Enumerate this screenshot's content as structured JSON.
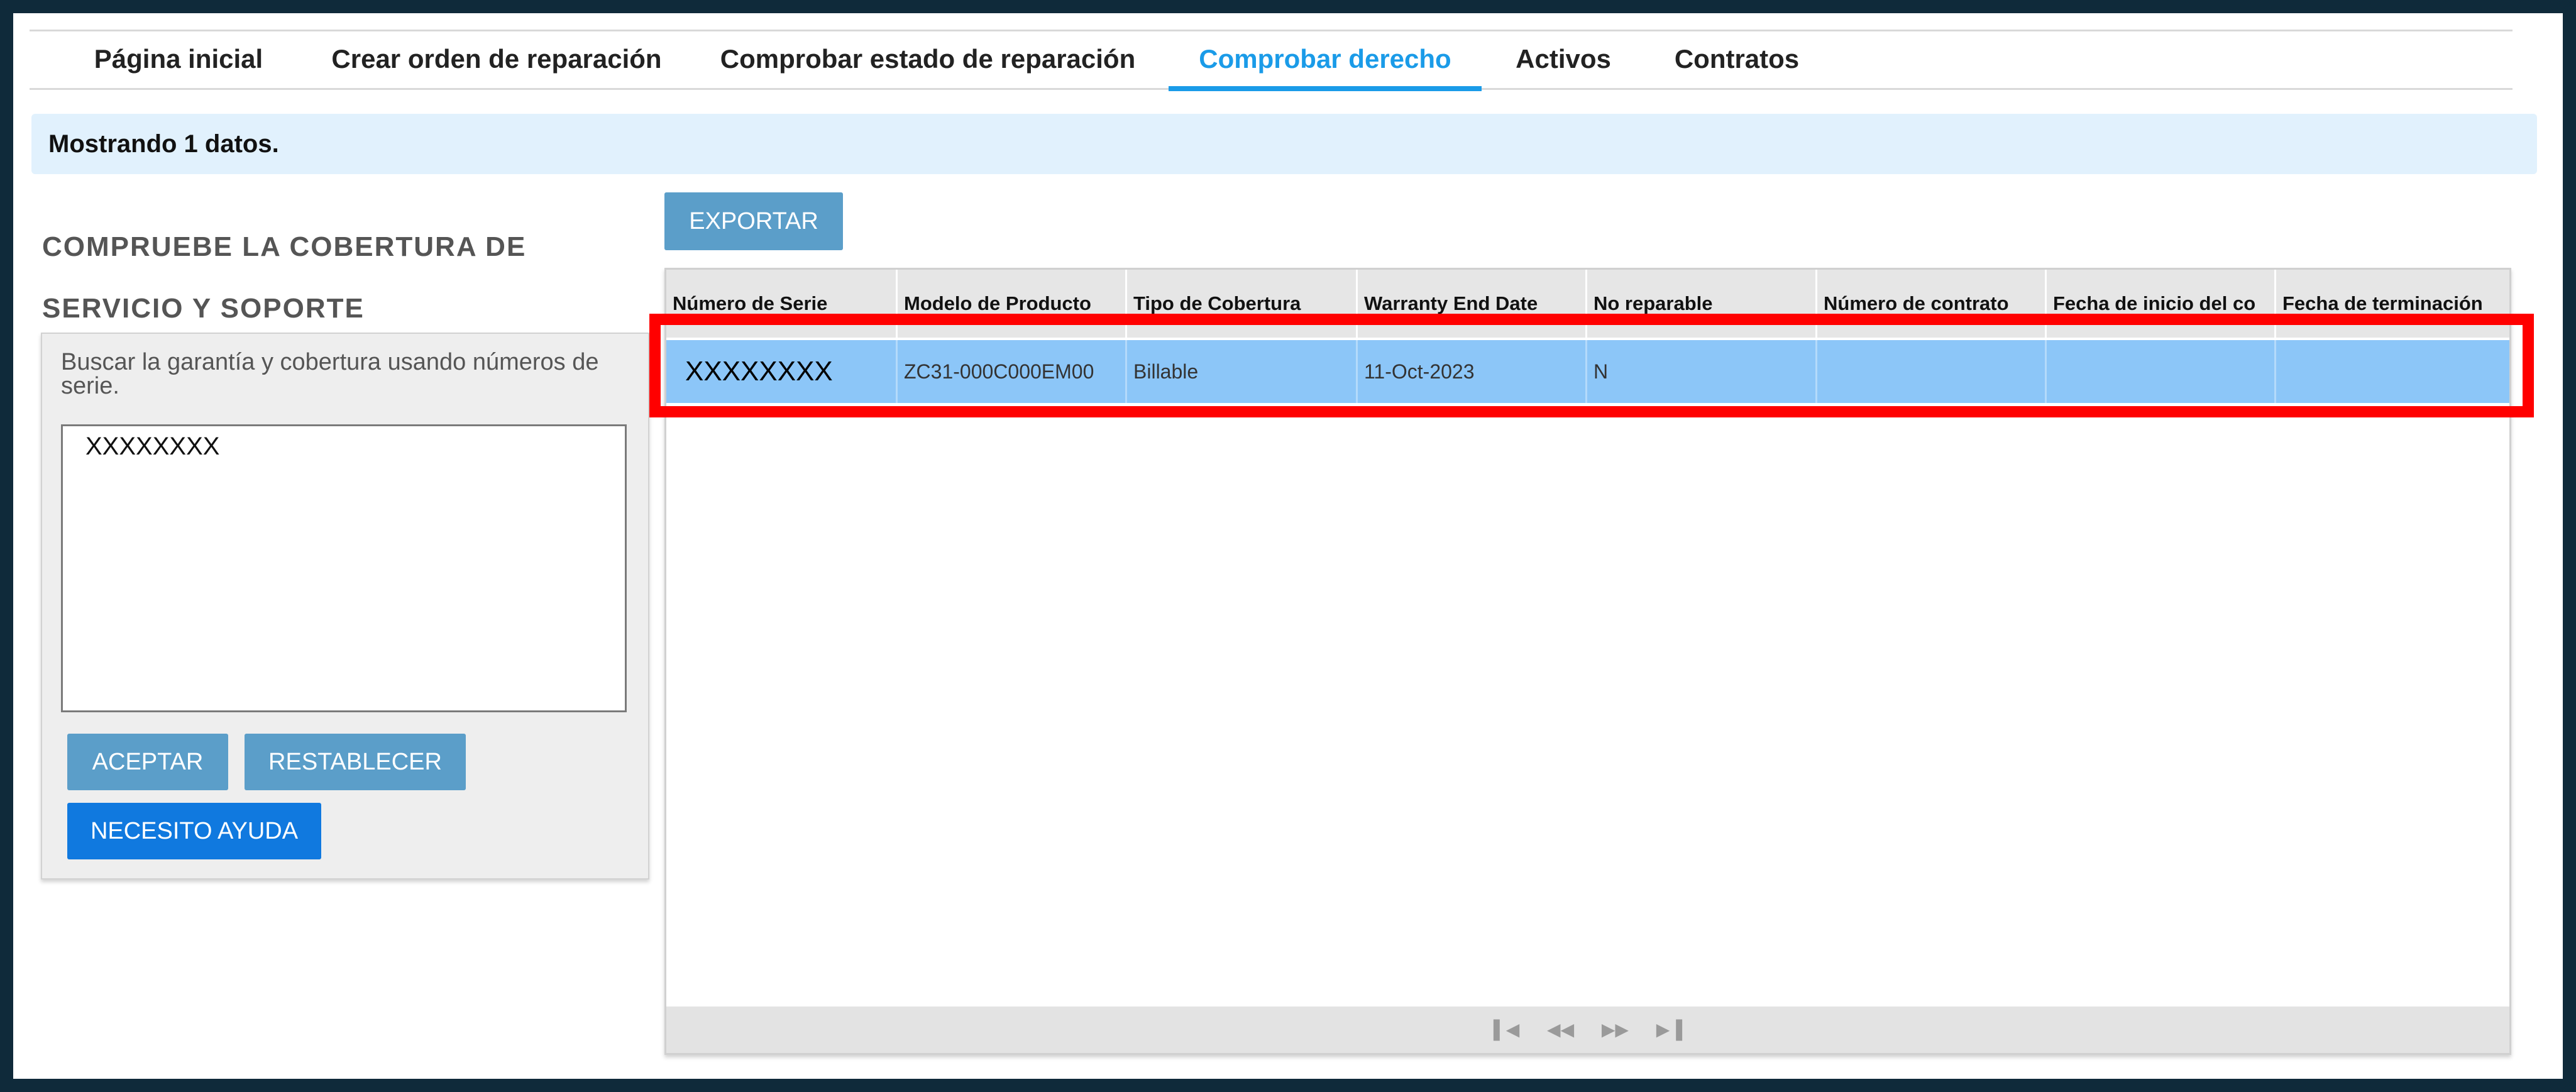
{
  "nav": {
    "tabs": [
      {
        "label": "Página inicial"
      },
      {
        "label": "Crear orden de reparación"
      },
      {
        "label": "Comprobar estado de reparación"
      },
      {
        "label": "Comprobar derecho",
        "active": true
      },
      {
        "label": "Activos"
      },
      {
        "label": "Contratos"
      }
    ]
  },
  "info_banner": "Mostrando 1 datos.",
  "left_panel": {
    "title_line1": "COMPRUEBE LA COBERTURA DE",
    "title_line2": "SERVICIO Y SOPORTE",
    "description": "Buscar la garantía y cobertura usando números de serie.",
    "serial_input_value": "XXXXXXXX",
    "accept_label": "ACEPTAR",
    "reset_label": "RESTABLECER",
    "help_label": "NECESITO AYUDA"
  },
  "toolbar": {
    "export_label": "EXPORTAR"
  },
  "table": {
    "columns": [
      "Número de Serie",
      "Modelo de Producto",
      "Tipo de Cobertura",
      "Warranty End Date",
      "No reparable",
      "Número de contrato",
      "Fecha de inicio del co",
      "Fecha de terminación"
    ],
    "rows": [
      [
        "XXXXXXXX",
        "ZC31-000C000EM00",
        "Billable",
        "11-Oct-2023",
        "N",
        "",
        "",
        ""
      ]
    ]
  },
  "pager": {
    "first_icon": "first-page-icon",
    "prev_icon": "prev-page-icon",
    "next_icon": "next-page-icon",
    "last_icon": "last-page-icon"
  },
  "colors": {
    "accent": "#1a9be8",
    "selected_row": "#8cc6f8",
    "highlight": "#ff0000",
    "button": "#5b9ec9",
    "button_primary": "#1079df"
  }
}
